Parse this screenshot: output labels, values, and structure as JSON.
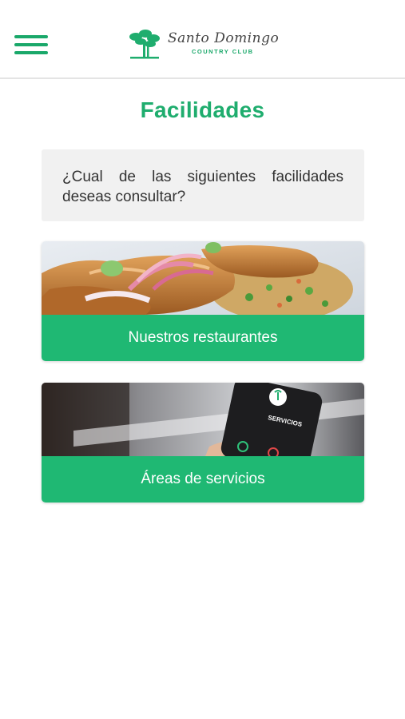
{
  "header": {
    "menu_icon": "hamburger-menu-icon",
    "logo": {
      "script_text": "Santo Domingo",
      "sub_text": "COUNTRY CLUB"
    }
  },
  "page": {
    "title": "Facilidades",
    "question": "¿Cual de las siguientes facilidades deseas consultar?"
  },
  "cards": [
    {
      "label": "Nuestros restaurantes",
      "image": "food-dish-photo"
    },
    {
      "label": "Áreas de servicios",
      "image": "phone-call-photo",
      "phone_screen_text": "SERVICIOS"
    }
  ],
  "colors": {
    "accent": "#1fb873",
    "title": "#1fad6e",
    "question_bg": "#f1f1f1"
  }
}
